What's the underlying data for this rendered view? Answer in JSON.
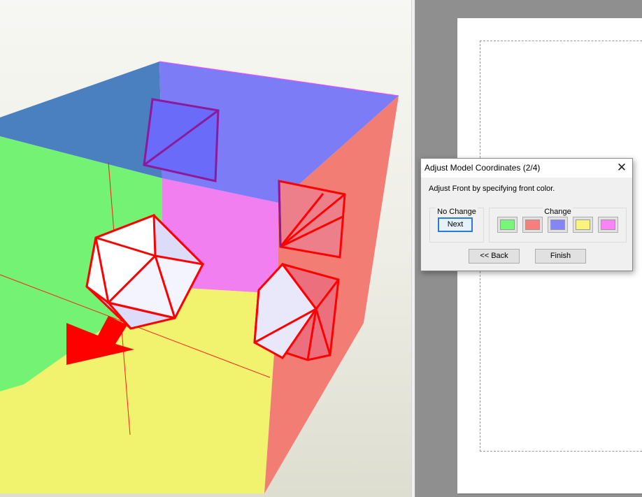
{
  "dialog": {
    "title": "Adjust Model Coordinates (2/4)",
    "close_glyph": "✕",
    "message": "Adjust Front by specifying front color.",
    "no_change_group": {
      "title": "No Change",
      "next_label": "Next"
    },
    "change_group": {
      "title": "Change",
      "swatches": [
        {
          "name": "green",
          "color": "#77f67a"
        },
        {
          "name": "red",
          "color": "#f47f7c"
        },
        {
          "name": "blue",
          "color": "#8585f5"
        },
        {
          "name": "yellow",
          "color": "#f8f47e"
        },
        {
          "name": "magenta",
          "color": "#f884f7"
        }
      ]
    },
    "back_label": "<< Back",
    "finish_label": "Finish"
  },
  "model": {
    "face_colors": {
      "top": "#4a7fc0",
      "back": "#7c7cf7",
      "left": "#73f273",
      "right": "#f27d74",
      "bottom": "#f1f26d",
      "inner_back": "#f27ff0",
      "highlight_edge": "#ff0000",
      "shape_fill": "#dcdcf8"
    }
  }
}
